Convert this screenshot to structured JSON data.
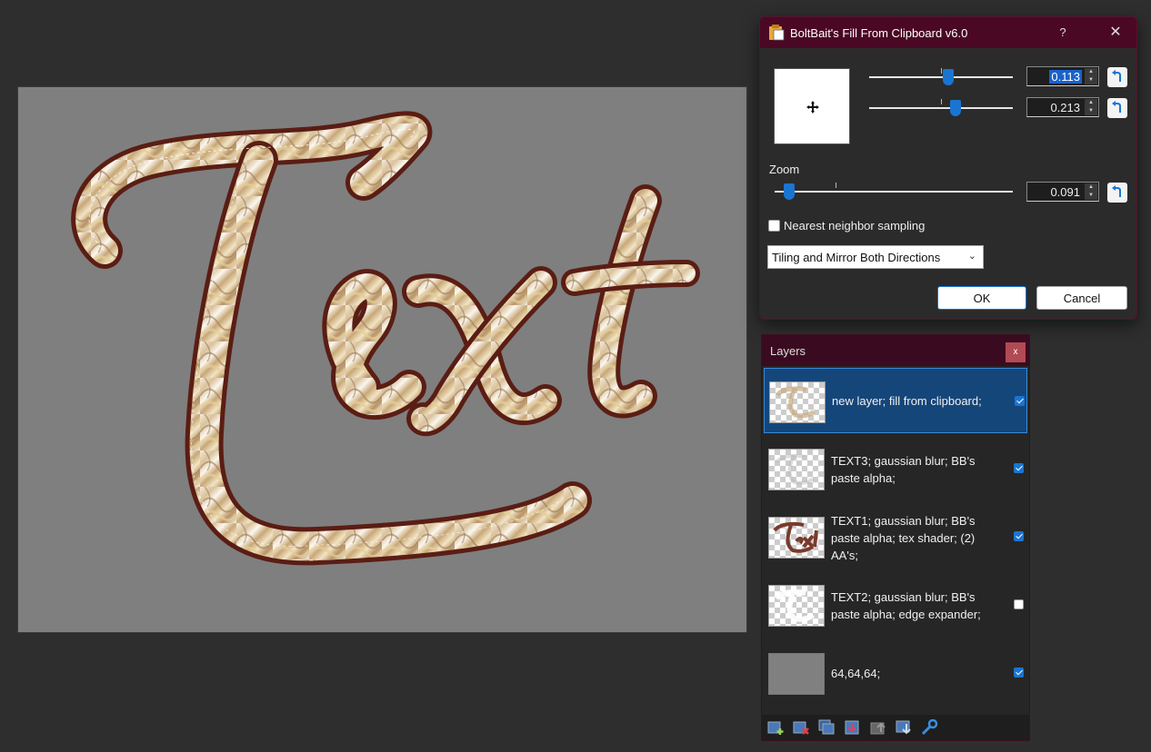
{
  "dialog": {
    "title": "BoltBait's Fill From Clipboard v6.0",
    "help_label": "?",
    "close_label": "✕",
    "offset_x": {
      "value": "0.113",
      "slider_fraction": 0.55
    },
    "offset_y": {
      "value": "0.213",
      "slider_fraction": 0.6
    },
    "zoom": {
      "label": "Zoom",
      "value": "0.091",
      "slider_fraction": 0.06
    },
    "nearest_neighbor": {
      "label": "Nearest neighbor sampling",
      "checked": false
    },
    "tiling_mode": {
      "selected": "Tiling and Mirror Both Directions"
    },
    "ok_label": "OK",
    "cancel_label": "Cancel",
    "accent_color": "#1a75d2",
    "title_bar_color": "#4a0824"
  },
  "layers_panel": {
    "title": "Layers",
    "close_label": "x",
    "items": [
      {
        "name": "new layer; fill from clipboard;",
        "visible": true,
        "selected": true,
        "thumb": "marble"
      },
      {
        "name": "TEXT3; gaussian blur; BB's paste alpha;",
        "visible": true,
        "selected": false,
        "thumb": "faint"
      },
      {
        "name": "TEXT1; gaussian blur; BB's paste alpha; tex shader; (2) AA's;",
        "visible": true,
        "selected": false,
        "thumb": "text"
      },
      {
        "name": "TEXT2; gaussian blur; BB's paste alpha; edge expander;",
        "visible": false,
        "selected": false,
        "thumb": "outline"
      },
      {
        "name": "64,64,64;",
        "visible": true,
        "selected": false,
        "thumb": "solid"
      }
    ],
    "toolbar": [
      "add-layer-icon",
      "delete-layer-icon",
      "duplicate-layer-icon",
      "merge-down-icon",
      "move-layer-up-icon",
      "move-layer-down-icon",
      "layer-properties-icon"
    ]
  }
}
